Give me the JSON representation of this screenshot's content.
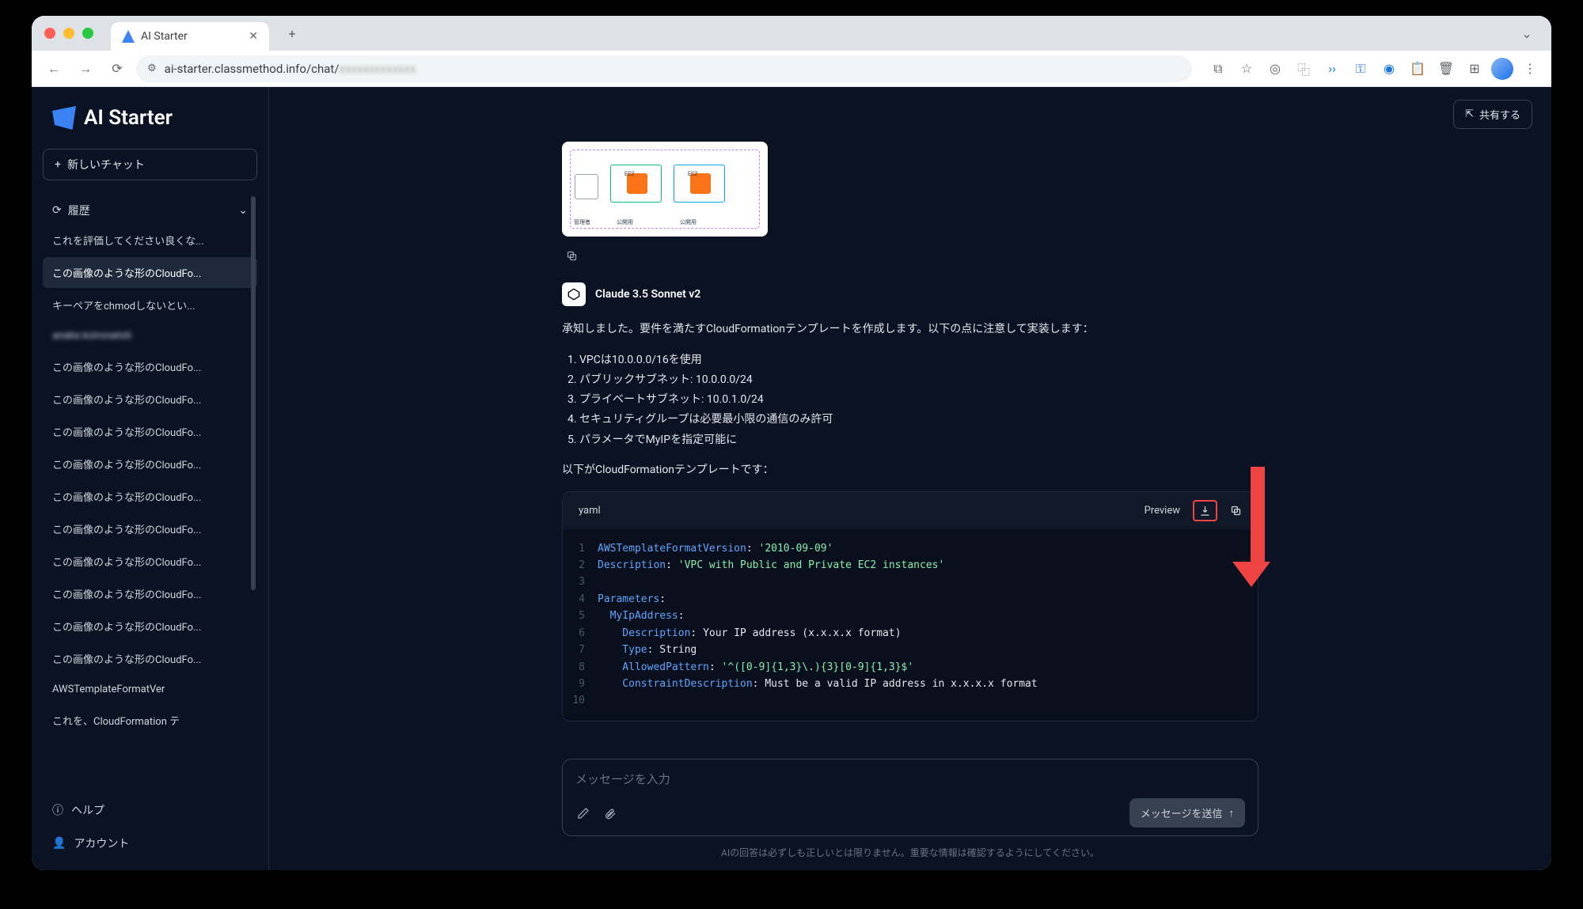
{
  "browser": {
    "tab_title": "AI Starter",
    "url_host": "ai-starter.classmethod.info/chat/",
    "url_path_blurred": "xxxxxxxxxxxxx"
  },
  "sidebar": {
    "logo_text": "AI Starter",
    "new_chat": "新しいチャット",
    "history_label": "履歴",
    "history_items": [
      {
        "label": "これを評価してください良くな...",
        "active": false,
        "blurred": false
      },
      {
        "label": "この画像のような形のCloudFo...",
        "active": true,
        "blurred": false
      },
      {
        "label": "キーペアをchmodしないとい...",
        "active": false,
        "blurred": false
      },
      {
        "label": "anaka koironatoti",
        "active": false,
        "blurred": true
      },
      {
        "label": "この画像のような形のCloudFo...",
        "active": false,
        "blurred": false
      },
      {
        "label": "この画像のような形のCloudFo...",
        "active": false,
        "blurred": false
      },
      {
        "label": "この画像のような形のCloudFo...",
        "active": false,
        "blurred": false
      },
      {
        "label": "この画像のような形のCloudFo...",
        "active": false,
        "blurred": false
      },
      {
        "label": "この画像のような形のCloudFo...",
        "active": false,
        "blurred": false
      },
      {
        "label": "この画像のような形のCloudFo...",
        "active": false,
        "blurred": false
      },
      {
        "label": "この画像のような形のCloudFo...",
        "active": false,
        "blurred": false
      },
      {
        "label": "この画像のような形のCloudFo...",
        "active": false,
        "blurred": false
      },
      {
        "label": "この画像のような形のCloudFo...",
        "active": false,
        "blurred": false
      },
      {
        "label": "この画像のような形のCloudFo...",
        "active": false,
        "blurred": false
      },
      {
        "label": "AWSTemplateFormatVer",
        "active": false,
        "blurred": false
      },
      {
        "label": "これを、CloudFormation テ",
        "active": false,
        "blurred": false
      }
    ],
    "help": "ヘルプ",
    "account": "アカウント"
  },
  "header": {
    "share": "共有する"
  },
  "chat": {
    "model_name": "Claude 3.5 Sonnet v2",
    "intro": "承知しました。要件を満たすCloudFormationテンプレートを作成します。以下の点に注意して実装します：",
    "points": [
      "VPCは10.0.0.0/16を使用",
      "パブリックサブネット: 10.0.0.0/24",
      "プライベートサブネット: 10.0.1.0/24",
      "セキュリティグループは必要最小限の通信のみ許可",
      "パラメータでMyIPを指定可能に"
    ],
    "outro": "以下がCloudFormationテンプレートです：",
    "code": {
      "lang": "yaml",
      "preview": "Preview",
      "lines": [
        {
          "n": 1,
          "k": "AWSTemplateFormatVersion",
          "c": ": ",
          "v": "'2010-09-09'"
        },
        {
          "n": 2,
          "k": "Description",
          "c": ": ",
          "v": "'VPC with Public and Private EC2 instances'"
        },
        {
          "n": 3,
          "k": "",
          "c": "",
          "v": ""
        },
        {
          "n": 4,
          "k": "Parameters",
          "c": ":",
          "v": ""
        },
        {
          "n": 5,
          "k": "  MyIpAddress",
          "c": ":",
          "v": ""
        },
        {
          "n": 6,
          "k": "    Description",
          "c": ": ",
          "v2": "Your IP address (x.x.x.x format)"
        },
        {
          "n": 7,
          "k": "    Type",
          "c": ": ",
          "v2": "String"
        },
        {
          "n": 8,
          "k": "    AllowedPattern",
          "c": ": ",
          "v": "'^([0-9]{1,3}\\.){3}[0-9]{1,3}$'"
        },
        {
          "n": 9,
          "k": "    ConstraintDescription",
          "c": ": ",
          "v2": "Must be a valid IP address in x.x.x.x format"
        },
        {
          "n": 10,
          "k": "",
          "c": "",
          "v": ""
        }
      ]
    }
  },
  "input": {
    "placeholder": "メッセージを入力",
    "send": "メッセージを送信"
  },
  "disclaimer": "AIの回答は必ずしも正しいとは限りません。重要な情報は確認するようにしてください。"
}
